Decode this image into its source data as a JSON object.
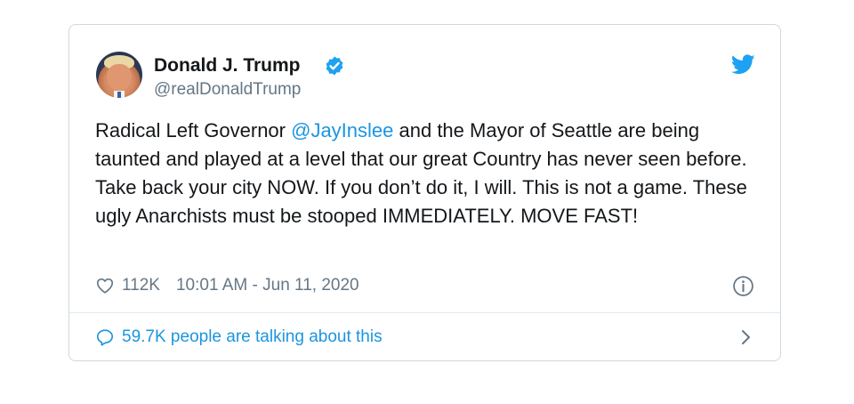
{
  "author": {
    "name": "Donald J. Trump",
    "handle": "@realDonaldTrump",
    "verified": true,
    "avatar_icon": "profile-photo"
  },
  "tweet": {
    "text_before_mention": "Radical Left Governor ",
    "mention": "@JayInslee",
    "text_after_mention": " and the Mayor of Seattle are being taunted and played at a level that our great Country has never seen before. Take back your city NOW. If you don’t do it, I will. This is not a game. These ugly Anarchists must be stooped IMMEDIATELY. MOVE FAST!"
  },
  "stats": {
    "likes": "112K",
    "timestamp": "10:01 AM - Jun 11, 2020"
  },
  "footer": {
    "talking_text": "59.7K people are talking about this"
  },
  "icons": {
    "brand": "twitter-bird-icon",
    "verified": "verified-badge-icon",
    "like": "heart-icon",
    "info": "info-icon",
    "comment": "speech-bubble-icon",
    "more": "chevron-right-icon"
  },
  "colors": {
    "brand_blue": "#1da1f2",
    "link_blue": "#1b95e0",
    "text": "#14171a",
    "muted": "#657786",
    "border": "#cfd9de"
  }
}
